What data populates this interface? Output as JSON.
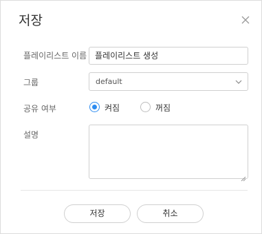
{
  "dialog": {
    "title": "저장",
    "close_icon": "close-icon"
  },
  "form": {
    "name": {
      "label": "플레이리스트 이름",
      "value": "플레이리스트 생성"
    },
    "group": {
      "label": "그룹",
      "selected": "default",
      "arrow_icon": "chevron-down-icon"
    },
    "share": {
      "label": "공유 여부",
      "options": [
        {
          "label": "켜짐",
          "checked": true
        },
        {
          "label": "꺼짐",
          "checked": false
        }
      ]
    },
    "description": {
      "label": "설명",
      "value": ""
    }
  },
  "buttons": {
    "save_label": "저장",
    "cancel_label": "취소"
  },
  "colors": {
    "accent": "#2d8cf0",
    "border": "#cfcfcf",
    "label": "#666666"
  }
}
